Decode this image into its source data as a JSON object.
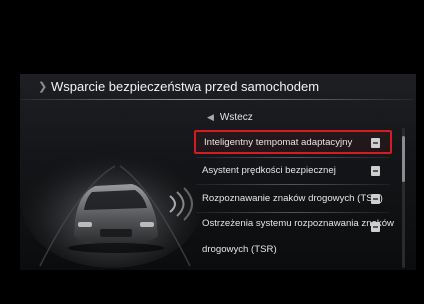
{
  "header": {
    "title": "Wsparcie bezpieczeństwa przed samochodem",
    "chevron_icon": "chevron-right-icon"
  },
  "back": {
    "label": "Wstecz",
    "icon": "back-arrow-icon"
  },
  "menu": {
    "items": [
      {
        "label": "Inteligentny tempomat adaptacyjny",
        "selected": true,
        "trailing_icon": "submenu-box-icon"
      },
      {
        "label": "Asystent prędkości bezpiecznej",
        "selected": false,
        "trailing_icon": "submenu-box-icon"
      },
      {
        "label": "Rozpoznawanie znaków drogowych (TSR)",
        "selected": false,
        "trailing_icon": "submenu-box-icon"
      },
      {
        "label_line1": "Ostrzeżenia systemu rozpoznawania znaków",
        "label_line2": "drogowych (TSR)",
        "selected": false,
        "trailing_icon": "submenu-box-icon"
      }
    ]
  },
  "colors": {
    "selection_border": "#d51c24",
    "background": "#000000"
  }
}
